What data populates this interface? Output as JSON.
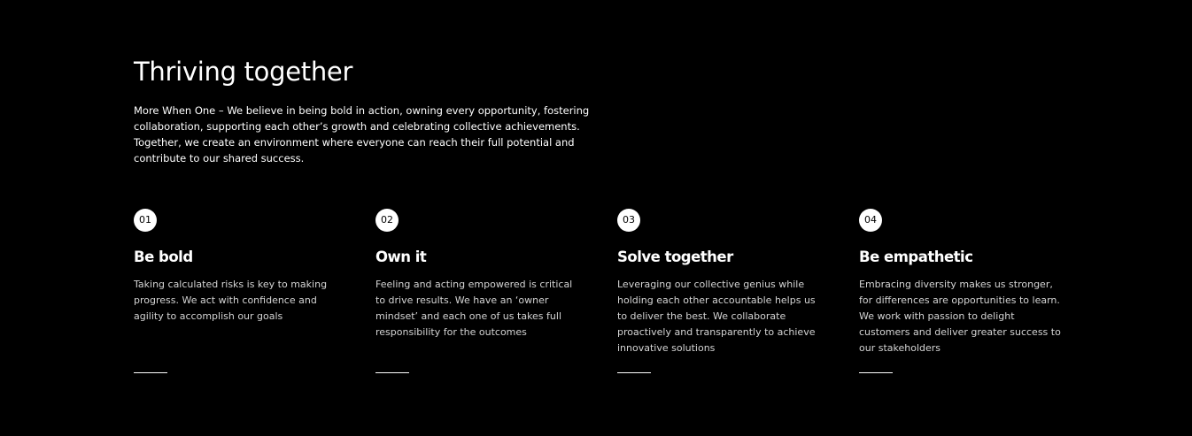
{
  "section": {
    "title": "Thriving together",
    "intro": "More When One – We believe in being bold in action, owning every opportunity, fostering collaboration, supporting each other’s growth and celebrating collective achievements. Together, we create an environment where everyone can reach their full potential and contribute to our shared success."
  },
  "values": [
    {
      "number": "01",
      "title": "Be bold",
      "text": "Taking calculated risks is key to making progress. We act with confidence and agility to accomplish our goals"
    },
    {
      "number": "02",
      "title": "Own it",
      "text": "Feeling and acting empowered is critical to drive results. We have an ‘owner mindset’ and each one of us takes full responsibility for the outcomes"
    },
    {
      "number": "03",
      "title": "Solve together",
      "text": "Leveraging our collective genius while holding each other accountable helps us to deliver the best. We collaborate proactively and transparently to achieve innovative solutions"
    },
    {
      "number": "04",
      "title": "Be empathetic",
      "text": "Embracing diversity makes us stronger, for differences are opportunities to learn. We work with passion to delight customers and deliver greater success to our stakeholders"
    }
  ],
  "colors": {
    "background": "#000000",
    "text": "#ffffff",
    "body_text": "#d4d4d4",
    "badge_background": "#ffffff",
    "badge_text": "#000000"
  }
}
